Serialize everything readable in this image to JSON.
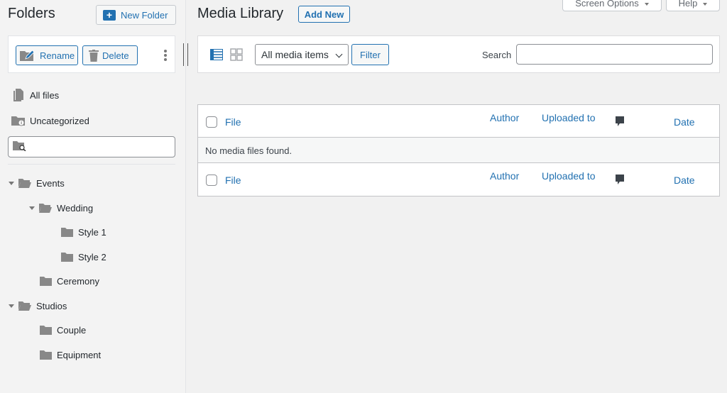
{
  "sidebar": {
    "title": "Folders",
    "new_folder_label": "New Folder",
    "rename_label": "Rename",
    "delete_label": "Delete",
    "all_files_label": "All files",
    "uncategorized_label": "Uncategorized",
    "search_placeholder": "",
    "tree": {
      "events": "Events",
      "wedding": "Wedding",
      "style1": "Style 1",
      "style2": "Style 2",
      "ceremony": "Ceremony",
      "studios": "Studios",
      "couple": "Couple",
      "equipment": "Equipment"
    }
  },
  "header": {
    "title": "Media Library",
    "add_new_label": "Add New",
    "screen_options_label": "Screen Options",
    "help_label": "Help"
  },
  "toolbar": {
    "media_filter_value": "All media items",
    "filter_label": "Filter",
    "search_label": "Search",
    "search_value": ""
  },
  "table": {
    "columns": {
      "file": "File",
      "author": "Author",
      "uploaded_to": "Uploaded to",
      "date": "Date"
    },
    "empty_message": "No media files found."
  },
  "colors": {
    "accent": "#2271b1",
    "background": "#f1f1f1"
  },
  "icons": [
    "plus-icon",
    "folder-edit-icon",
    "trash-icon",
    "kebab-menu-icon",
    "file-icon",
    "folder-info-icon",
    "folder-search-icon",
    "folder-open-icon",
    "folder-icon",
    "list-view-icon",
    "grid-view-icon",
    "comment-icon"
  ]
}
